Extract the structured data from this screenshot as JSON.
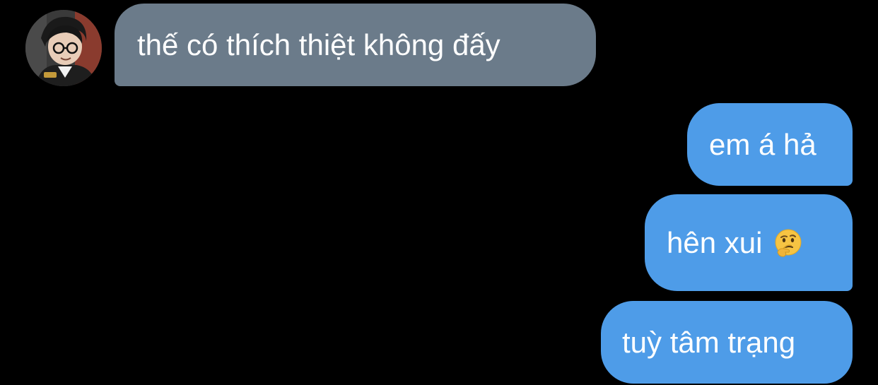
{
  "conversation": {
    "incoming": [
      {
        "text": "thế có thích thiệt không đấy",
        "avatar_icon": "profile-photo-icon"
      }
    ],
    "outgoing": [
      {
        "text": "em á hả"
      },
      {
        "text": "hên xui",
        "emoji": "thinking-face-icon"
      },
      {
        "text": "tuỳ tâm trạng"
      }
    ]
  },
  "colors": {
    "background": "#000000",
    "incoming_bubble": "#6b7b8a",
    "outgoing_bubble": "#4e9ce8",
    "text": "#ffffff"
  }
}
